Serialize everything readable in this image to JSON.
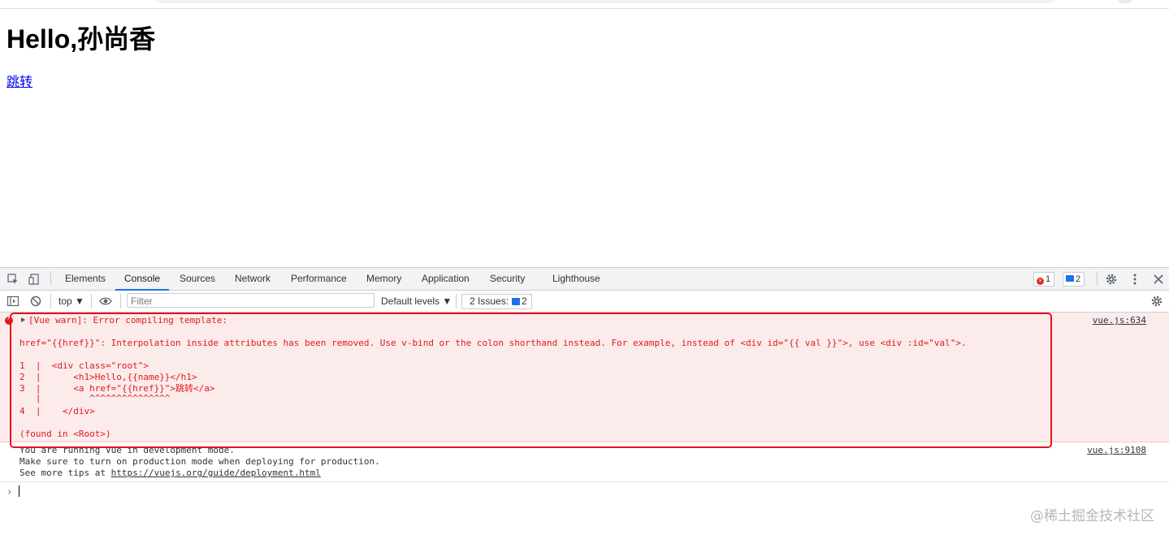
{
  "page": {
    "heading": "Hello,孙尚香",
    "link_text": "跳转"
  },
  "devtools": {
    "tabs": [
      "Elements",
      "Console",
      "Sources",
      "Network",
      "Performance",
      "Memory",
      "Application",
      "Security",
      "Lighthouse"
    ],
    "active_tab": "Console",
    "error_count": "1",
    "message_count": "2",
    "context": "top ▼",
    "filter_placeholder": "Filter",
    "default_levels": "Default levels ▼",
    "issues_label": "2 Issues:",
    "issues_count": "2"
  },
  "console": {
    "error": {
      "title": "[Vue warn]: Error compiling template:",
      "message": "href=\"{{href}}\": Interpolation inside attributes has been removed. Use v-bind or the colon shorthand instead. For example, instead of <div id=\"{{ val }}\">, use <div :id=\"val\">.",
      "code_lines": [
        "1  |  <div class=\"root\">",
        "2  |      <h1>Hello,{{name}}</h1>",
        "3  |      <a href=\"{{href}}\">跳转</a>",
        "   |         ^^^^^^^^^^^^^^^",
        "4  |    </div>"
      ],
      "found_in": "(found in <Root>)",
      "source": "vue.js:634"
    },
    "info": {
      "line1": "You are running Vue in development mode.",
      "line2": "Make sure to turn on production mode when deploying for production.",
      "line3_prefix": "See more tips at ",
      "line3_link": "https://vuejs.org/guide/deployment.html",
      "source": "vue.js:9108"
    },
    "prompt_symbol": "›"
  },
  "watermark": "@稀土掘金技术社区",
  "colors": {
    "error_text": "#e01a1a",
    "error_bg": "#fcebeb",
    "highlight_border": "#e8121f",
    "active_tab_underline": "#1a73e8"
  }
}
